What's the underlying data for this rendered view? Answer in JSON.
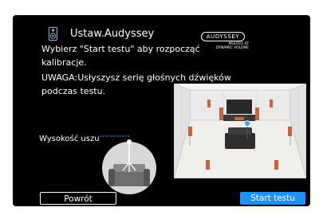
{
  "header": {
    "title": "Ustaw.Audyssey",
    "logo_text": "AUDYSSEY",
    "logo_subtext_1": "MULTEQ XT",
    "logo_subtext_2": "DYNAMIC VOLUME"
  },
  "instructions": {
    "line1": "Wybierz \"Start testu\" aby rozpocząć",
    "line2": "kalibracje.",
    "line3": "UWAGA:Usłyszysz serię głośnych dźwięków",
    "line4": "podczas testu."
  },
  "ear_height_label": "Wysokość uszu",
  "buttons": {
    "back": "Powrót",
    "start": "Start testu"
  },
  "icons": {
    "speaker": "speaker-icon",
    "microphone": "microphone-icon"
  },
  "colors": {
    "background": "#000000",
    "accent": "#1e90ff",
    "speaker": "#c8643c"
  }
}
